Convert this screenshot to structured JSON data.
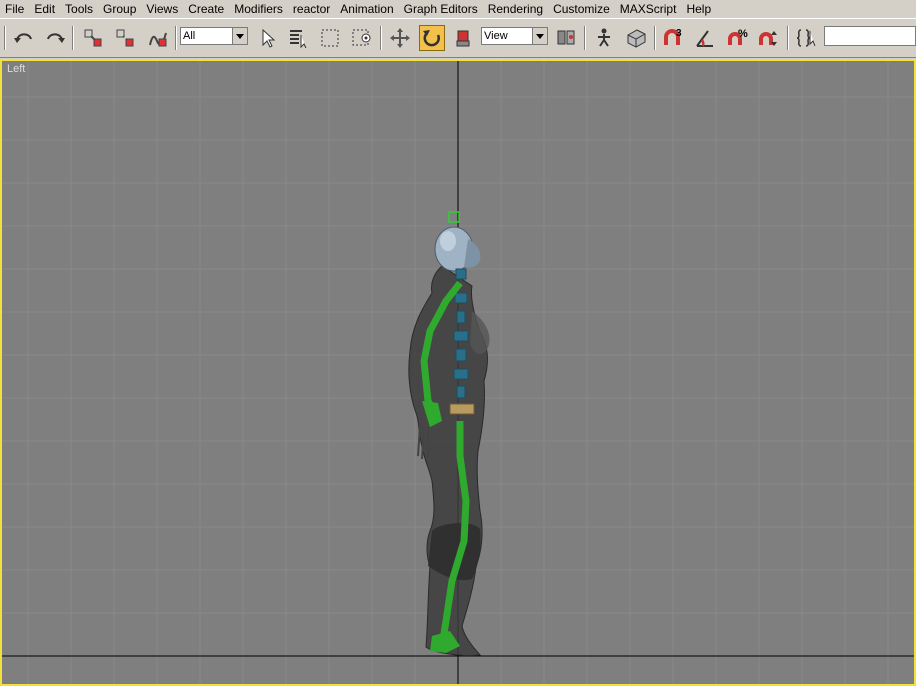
{
  "menu": {
    "items": [
      "File",
      "Edit",
      "Tools",
      "Group",
      "Views",
      "Create",
      "Modifiers",
      "reactor",
      "Animation",
      "Graph Editors",
      "Rendering",
      "Customize",
      "MAXScript",
      "Help"
    ]
  },
  "toolbar": {
    "selection_filter": "All",
    "reference_coord": "View",
    "buttons": [
      {
        "name": "undo-icon"
      },
      {
        "name": "redo-icon"
      },
      {
        "name": "select-and-link-icon"
      },
      {
        "name": "unlink-selection-icon"
      },
      {
        "name": "bind-to-space-warp-icon"
      },
      {
        "name": "select-object-icon"
      },
      {
        "name": "select-by-name-icon"
      },
      {
        "name": "rectangular-selection-icon"
      },
      {
        "name": "window-crossing-icon"
      },
      {
        "name": "select-and-move-icon"
      },
      {
        "name": "select-and-rotate-icon"
      },
      {
        "name": "select-and-scale-icon"
      },
      {
        "name": "use-pivot-center-icon"
      },
      {
        "name": "select-and-manipulate-icon"
      },
      {
        "name": "keyboard-shortcut-override-icon"
      },
      {
        "name": "snaps-toggle-icon"
      },
      {
        "name": "angle-snap-icon"
      },
      {
        "name": "percent-snap-icon"
      },
      {
        "name": "spinner-snap-icon"
      },
      {
        "name": "edit-named-selection-icon"
      }
    ],
    "snap_label": "3",
    "percent_label": "%"
  },
  "viewport": {
    "label": "Left",
    "border_color": "#f2e13a",
    "background": "#7f7f7f",
    "grid_color": "#8a8a8a",
    "axis_color": "#000000"
  }
}
